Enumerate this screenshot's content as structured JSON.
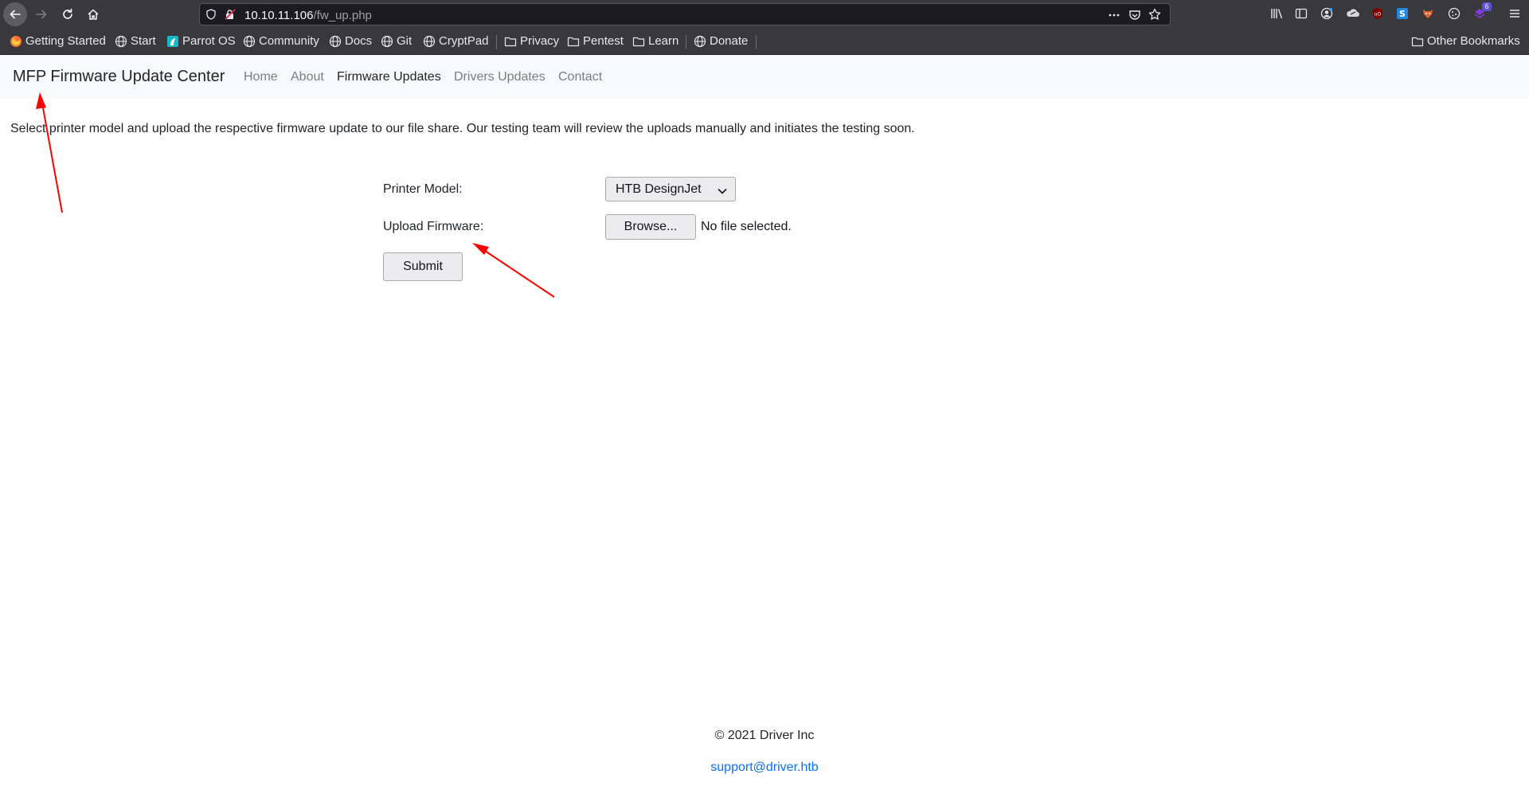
{
  "browser": {
    "url_host": "10.10.11.106",
    "url_path": "/fw_up.php",
    "extension_badge": "6",
    "bookmarks": [
      {
        "label": "Getting Started",
        "icon": "firefox-icon"
      },
      {
        "label": "Start",
        "icon": "globe-icon"
      },
      {
        "label": "Parrot OS",
        "icon": "parrot-icon"
      },
      {
        "label": "Community",
        "icon": "globe-icon"
      },
      {
        "label": "Docs",
        "icon": "globe-icon"
      },
      {
        "label": "Git",
        "icon": "globe-icon"
      },
      {
        "label": "CryptPad",
        "icon": "globe-icon"
      },
      {
        "label": "Privacy",
        "icon": "folder-icon"
      },
      {
        "label": "Pentest",
        "icon": "folder-icon"
      },
      {
        "label": "Learn",
        "icon": "folder-icon"
      },
      {
        "label": "Donate",
        "icon": "globe-icon"
      }
    ],
    "other_bookmarks": "Other Bookmarks"
  },
  "navbar": {
    "brand": "MFP Firmware Update Center",
    "links": [
      {
        "label": "Home",
        "active": false
      },
      {
        "label": "About",
        "active": false
      },
      {
        "label": "Firmware Updates",
        "active": true
      },
      {
        "label": "Drivers Updates",
        "active": false
      },
      {
        "label": "Contact",
        "active": false
      }
    ]
  },
  "main": {
    "intro": "Select printer model and upload the respective firmware update to our file share. Our testing team will review the uploads manually and initiates the testing soon.",
    "printer_model_label": "Printer Model:",
    "printer_model_value": "HTB DesignJet",
    "upload_label": "Upload Firmware:",
    "browse_label": "Browse...",
    "file_status": "No file selected.",
    "submit_label": "Submit"
  },
  "footer": {
    "copyright": "© 2021 Driver Inc",
    "email": "support@driver.htb"
  },
  "colors": {
    "chrome": "#38383d",
    "urlbar": "#1c1b22",
    "navbar": "#f8f9fa",
    "link": "#0d6efd",
    "annotation": "#ff0000"
  }
}
